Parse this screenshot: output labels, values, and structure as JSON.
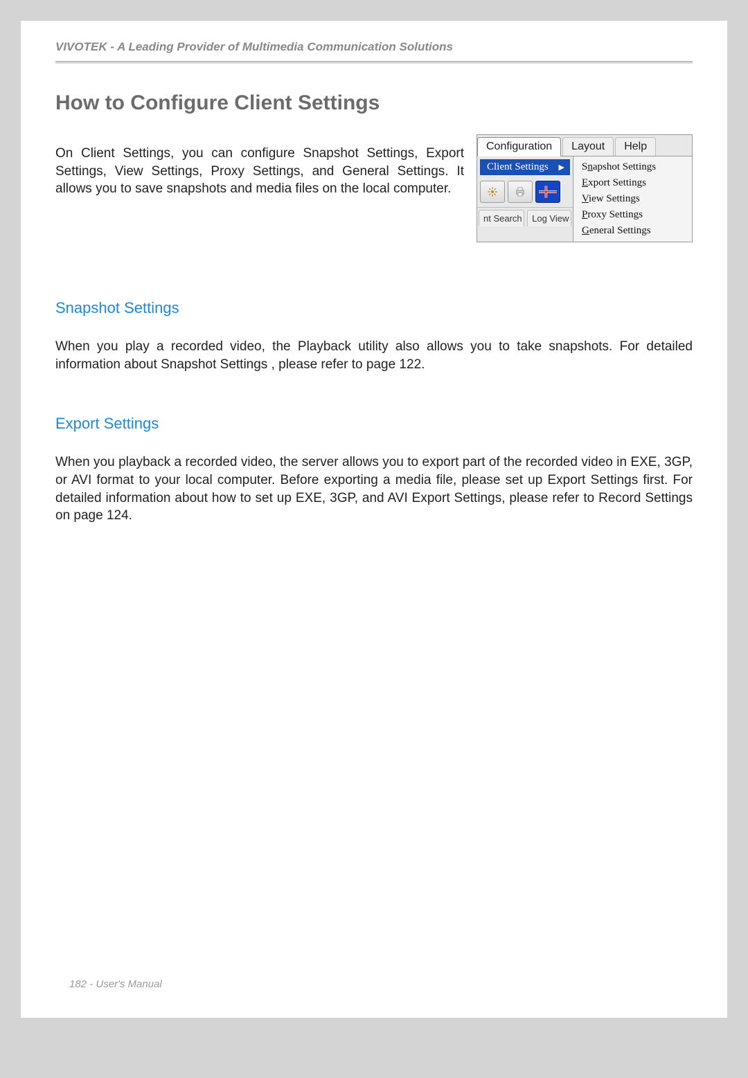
{
  "header": {
    "brand_line": "VIVOTEK - A Leading Provider of Multimedia Communication Solutions"
  },
  "title": "How to Configure Client Settings",
  "intro": "On Client Settings, you can configure Snapshot Settings, Export Settings, View Settings, Proxy Settings, and General Settings. It allows you to save snapshots and media files on the local computer.",
  "ui": {
    "tabs": {
      "configuration": "Configuration",
      "layout": "Layout",
      "help": "Help"
    },
    "client_settings_label": "Client Settings",
    "mini_tab_left": "nt Search",
    "mini_tab_right": "Log View",
    "menu": {
      "snapshot": {
        "pre": "S",
        "ul": "n",
        "post": "apshot Settings"
      },
      "export": {
        "pre": "",
        "ul": "E",
        "post": "xport Settings"
      },
      "view": {
        "pre": "",
        "ul": "V",
        "post": "iew Settings"
      },
      "proxy": {
        "pre": "",
        "ul": "P",
        "post": "roxy Settings"
      },
      "general": {
        "pre": "",
        "ul": "G",
        "post": "eneral Settings"
      }
    }
  },
  "sections": {
    "snapshot": {
      "title": "Snapshot Settings",
      "body": "When you play a recorded video, the Playback utility also allows you to take snapshots. For detailed information about Snapshot Settings  , please refer to page 122."
    },
    "export": {
      "title": "Export Settings",
      "body": "When you playback a recorded video, the server allows you to export part of the recorded video in EXE, 3GP, or AVI format to your local computer. Before exporting a media file, please set up Export Settings first. For detailed information about how to set up EXE, 3GP, and AVI Export Settings, please refer to Record Settings on page 124."
    }
  },
  "footer": "182 - User's Manual"
}
